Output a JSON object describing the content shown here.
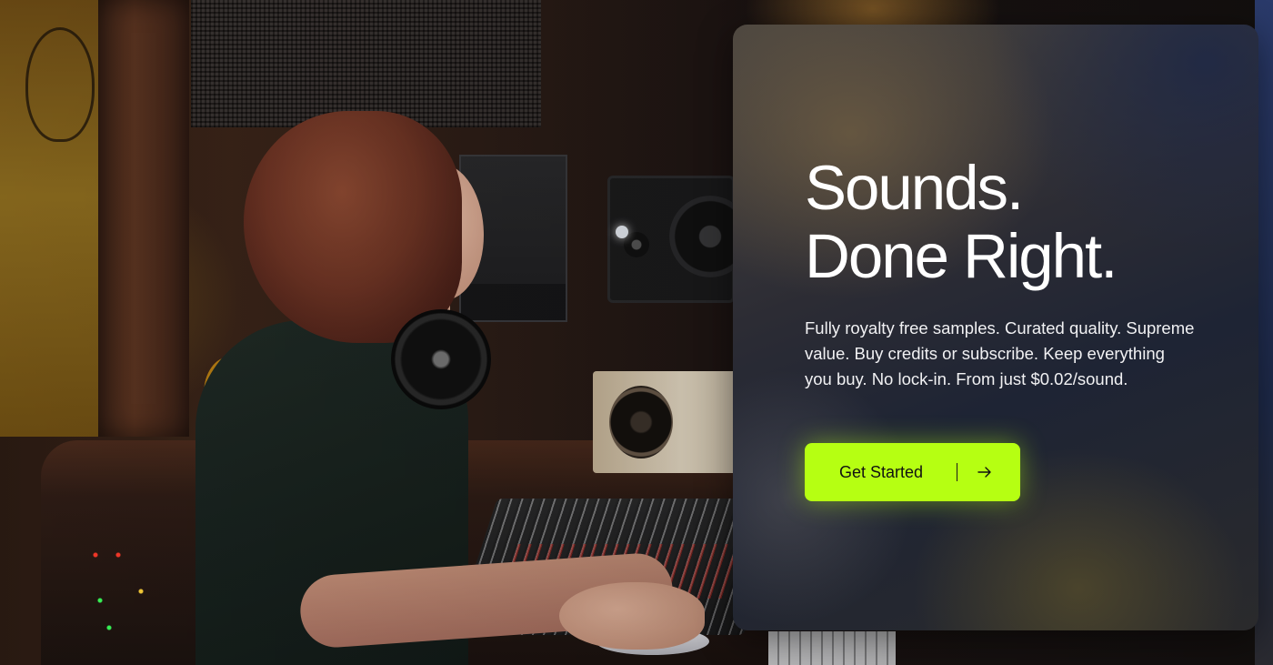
{
  "hero": {
    "headline_line1": "Sounds.",
    "headline_line2": "Done Right.",
    "description": "Fully royalty free samples. Curated quality. Supreme value. Buy credits or subscribe. Keep everything you buy. No lock-in. From just $0.02/sound.",
    "cta_label": "Get Started",
    "cta_icon": "arrow-right-icon"
  },
  "colors": {
    "cta_background": "#b6ff12",
    "cta_text": "#111111",
    "headline_text": "#ffffff"
  },
  "background_image": {
    "subject": "studio-scene-photo"
  }
}
